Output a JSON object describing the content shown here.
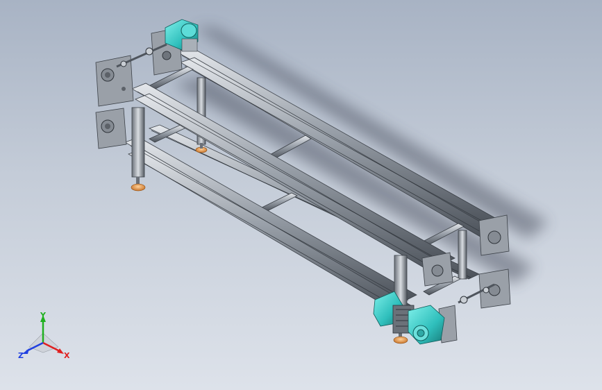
{
  "view": {
    "background_top": "#a8b3c4",
    "background_bottom": "#dde2ea",
    "model": "dual-belt-conveyor-frame"
  },
  "colors": {
    "aluminum": "#aeb4bc",
    "aluminum_dark": "#5f656d",
    "motor": "#30c3c0",
    "foot": "#e8a04a",
    "plate": "#9aa0a8"
  },
  "triad": {
    "x_label": "X",
    "y_label": "Y",
    "z_label": "Z",
    "x_color": "#e02020",
    "y_color": "#20b020",
    "z_color": "#2040e0"
  }
}
